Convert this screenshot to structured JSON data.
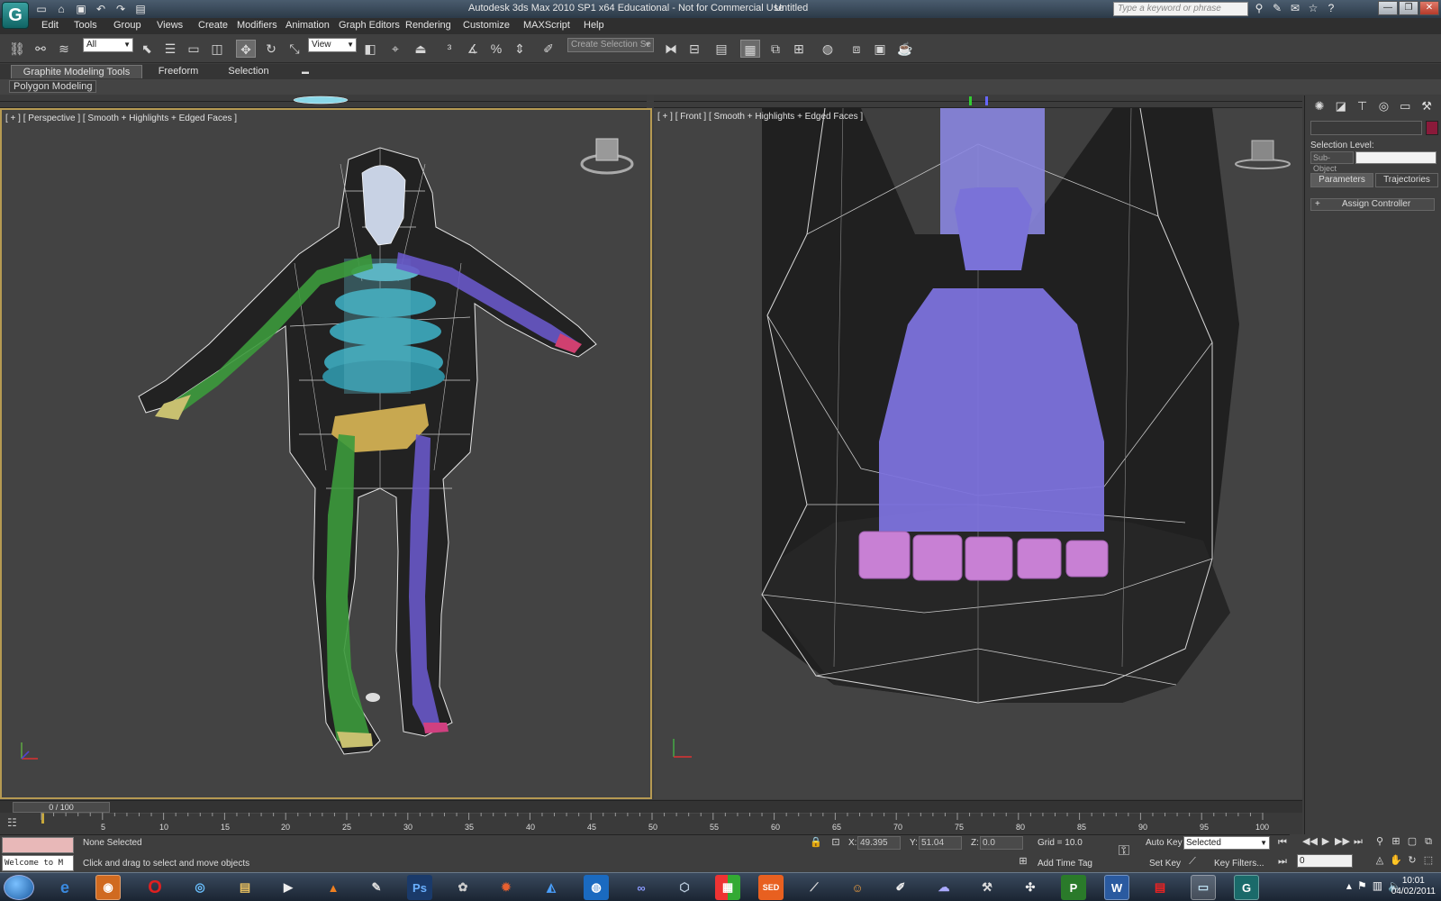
{
  "titlebar": {
    "app_title": "Autodesk 3ds Max  2010 SP1 x64   Educational - Not for Commercial Use",
    "doc_title": "Untitled",
    "search_placeholder": "Type a keyword or phrase"
  },
  "menu": [
    "Edit",
    "Tools",
    "Group",
    "Views",
    "Create",
    "Modifiers",
    "Animation",
    "Graph Editors",
    "Rendering",
    "Customize",
    "MAXScript",
    "Help"
  ],
  "toolbar": {
    "selection_filter": "All",
    "ref_coord": "View",
    "named_selection": "Create Selection Se"
  },
  "ribbon": {
    "tabs": [
      "Graphite Modeling Tools",
      "Freeform",
      "Selection"
    ],
    "panel_label": "Polygon Modeling"
  },
  "viewports": {
    "left": {
      "label": "[ + ] [ Perspective ] [ Smooth + Highlights + Edged Faces ]"
    },
    "right": {
      "label": "[ + ] [ Front ] [ Smooth + Highlights + Edged Faces ]"
    }
  },
  "command_panel": {
    "selection_level_label": "Selection Level:",
    "sub_object": "Sub-Object",
    "btn_parameters": "Parameters",
    "btn_trajectories": "Trajectories",
    "rollout_title": "Assign Controller"
  },
  "time_slider": {
    "label": "0 / 100",
    "ticks": [
      "5",
      "10",
      "15",
      "20",
      "25",
      "30",
      "35",
      "40",
      "45",
      "50",
      "55",
      "60",
      "65",
      "70",
      "75",
      "80",
      "85",
      "90",
      "95",
      "100"
    ]
  },
  "status": {
    "maxscript_listener": "Welcome to M",
    "selection": "None Selected",
    "prompt": "Click and drag to select and move objects",
    "x_label": "X:",
    "x_value": "49.395",
    "y_label": "Y:",
    "y_value": "51.04",
    "z_label": "Z:",
    "z_value": "0.0",
    "grid": "Grid = 10.0",
    "add_time_tag": "Add Time Tag",
    "auto_key": "Auto Key",
    "auto_key_mode": "Selected",
    "set_key": "Set Key",
    "key_filters": "Key Filters...",
    "frame": "0"
  },
  "taskbar": {
    "clock_time": "10:01",
    "clock_date": "04/02/2011"
  }
}
